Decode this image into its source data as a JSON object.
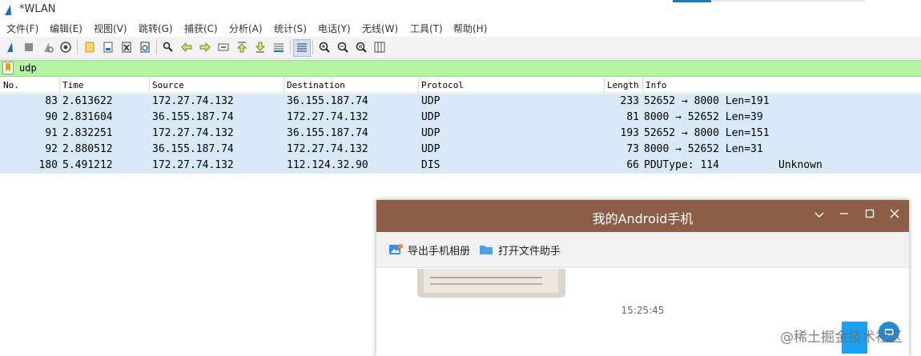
{
  "window": {
    "title": "*WLAN",
    "accent_color": "#1f7ac0"
  },
  "menu": [
    "文件(F)",
    "编辑(E)",
    "视图(V)",
    "跳转(G)",
    "捕获(C)",
    "分析(A)",
    "统计(S)",
    "电话(Y)",
    "无线(W)",
    "工具(T)",
    "帮助(H)"
  ],
  "toolbar": {
    "icons": [
      "start-capture-icon",
      "stop-capture-icon",
      "restart-capture-icon",
      "capture-options-icon",
      "open-file-icon",
      "save-file-icon",
      "close-file-icon",
      "reload-file-icon",
      "find-packet-icon",
      "go-back-icon",
      "go-forward-icon",
      "go-to-packet-icon",
      "first-packet-icon",
      "last-packet-icon",
      "autoscroll-icon",
      "colorize-icon",
      "zoom-in-icon",
      "zoom-out-icon",
      "normal-size-icon",
      "resize-columns-icon"
    ]
  },
  "filter": {
    "value": "udp",
    "bg_color": "#b5f2a2"
  },
  "packet_list": {
    "columns": [
      "No.",
      "Time",
      "Source",
      "Destination",
      "Protocol",
      "Length",
      "Info"
    ],
    "rows": [
      {
        "no": "83",
        "time": "2.613622",
        "source": "172.27.74.132",
        "destination": "36.155.187.74",
        "protocol": "UDP",
        "length": "233",
        "info": "52652 → 8000 Len=191",
        "extra": ""
      },
      {
        "no": "90",
        "time": "2.831604",
        "source": "36.155.187.74",
        "destination": "172.27.74.132",
        "protocol": "UDP",
        "length": "81",
        "info": "8000 → 52652 Len=39",
        "extra": ""
      },
      {
        "no": "91",
        "time": "2.832251",
        "source": "172.27.74.132",
        "destination": "36.155.187.74",
        "protocol": "UDP",
        "length": "193",
        "info": "52652 → 8000 Len=151",
        "extra": ""
      },
      {
        "no": "92",
        "time": "2.880512",
        "source": "36.155.187.74",
        "destination": "172.27.74.132",
        "protocol": "UDP",
        "length": "73",
        "info": "8000 → 52652 Len=31",
        "extra": ""
      },
      {
        "no": "180",
        "time": "5.491212",
        "source": "172.27.74.132",
        "destination": "112.124.32.90",
        "protocol": "DIS",
        "length": "66",
        "info": "PDUType: 114",
        "extra": "Unknown"
      }
    ],
    "row_color": "#dae9f8"
  },
  "android_window": {
    "title": "我的Android手机",
    "title_color": "#8c5d47",
    "export_album_label": "导出手机相册",
    "open_file_helper_label": "打开文件助手",
    "message_time": "15:25:45"
  },
  "watermark": "@稀土掘金技术社区"
}
